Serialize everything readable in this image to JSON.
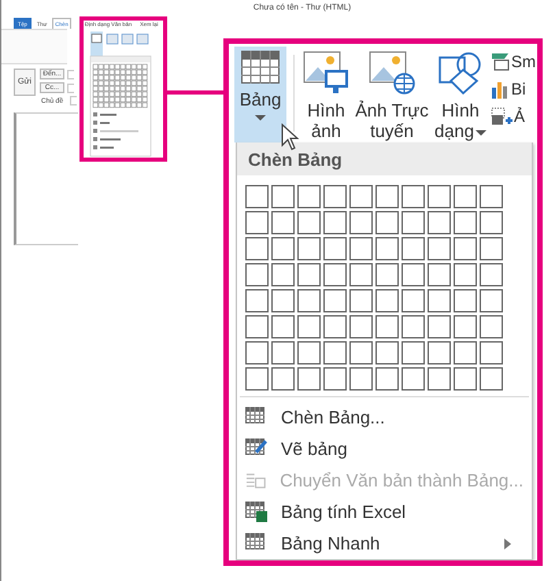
{
  "window": {
    "title": "Chưa có tên - Thư (HTML)"
  },
  "tabs": [
    {
      "label": "Tệp",
      "kind": "file",
      "selected": false
    },
    {
      "label": "Thư",
      "kind": "tab",
      "selected": false
    },
    {
      "label": "Chèn",
      "kind": "tab",
      "selected": true
    },
    {
      "label": "Định dạng Văn bản",
      "kind": "tab",
      "selected": false
    },
    {
      "label": "Xem lại",
      "kind": "tab",
      "selected": false
    }
  ],
  "compose": {
    "send": "Gửi",
    "to": "Đến...",
    "cc": "Cc...",
    "subject": "Chủ đề"
  },
  "callout": {
    "ribbon": [
      {
        "label": "Bảng",
        "kind": "table",
        "selected": true,
        "dropdown": true
      },
      {
        "label": "Hình ảnh",
        "kind": "picture",
        "selected": false,
        "dropdown": false
      },
      {
        "label": "Ảnh Trực tuyến",
        "kind": "online",
        "selected": false,
        "dropdown": false
      },
      {
        "label": "Hình dạng",
        "kind": "shapes",
        "selected": false,
        "dropdown": true
      }
    ],
    "side": [
      {
        "label": "Sm",
        "kind": "smartart"
      },
      {
        "label": "Bi",
        "kind": "chart"
      },
      {
        "label": "Ả",
        "kind": "screenshot"
      }
    ],
    "menu": {
      "header": "Chèn Bảng",
      "items": [
        {
          "label": "Chèn Bảng...",
          "kind": "insert",
          "disabled": false,
          "submenu": false
        },
        {
          "label": "Vẽ bảng",
          "kind": "draw",
          "disabled": false,
          "submenu": false
        },
        {
          "label": "Chuyển Văn bản thành Bảng...",
          "kind": "convert",
          "disabled": true,
          "submenu": false
        },
        {
          "label": "Bảng tính Excel",
          "kind": "excel",
          "disabled": false,
          "submenu": false
        },
        {
          "label": "Bảng Nhanh",
          "kind": "quick",
          "disabled": false,
          "submenu": true
        }
      ]
    }
  }
}
